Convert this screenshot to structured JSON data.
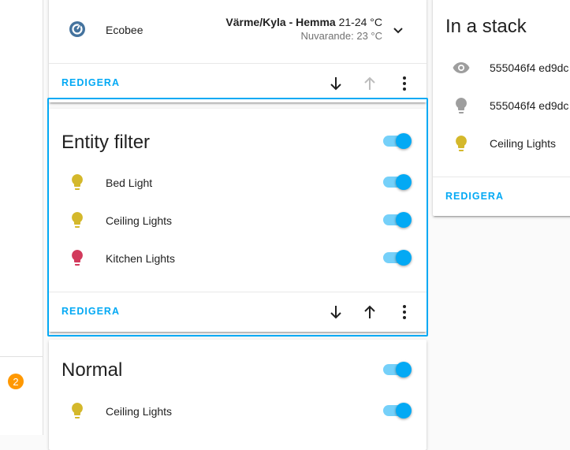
{
  "left_panel": {
    "badge_count": "2"
  },
  "thermostat_card": {
    "entity_name": "Ecobee",
    "state_label": "Värme/Kyla - Hemma",
    "range": "21-24 °C",
    "current": "Nuvarande: 23 °C",
    "edit_label": "REDIGERA"
  },
  "entity_filter_card": {
    "title": "Entity filter",
    "entities": [
      {
        "name": "Bed Light",
        "icon": "bulb-icon",
        "color": "#d4b82b"
      },
      {
        "name": "Ceiling Lights",
        "icon": "bulb-icon",
        "color": "#d4b82b"
      },
      {
        "name": "Kitchen Lights",
        "icon": "bulb-icon",
        "color": "#d23a5c"
      }
    ],
    "edit_label": "REDIGERA"
  },
  "normal_card": {
    "title": "Normal",
    "entities": [
      {
        "name": "Ceiling Lights",
        "icon": "bulb-icon",
        "color": "#d4b82b"
      }
    ]
  },
  "stack_card": {
    "title": "In a stack",
    "entities": [
      {
        "name": "555046f4 ed9dc",
        "icon": "eye-icon",
        "color": "#9e9e9e"
      },
      {
        "name": "555046f4 ed9dc",
        "icon": "bulb-icon",
        "color": "#9e9e9e"
      },
      {
        "name": "Ceiling Lights",
        "icon": "bulb-icon",
        "color": "#d4b82b"
      }
    ],
    "edit_label": "REDIGERA"
  },
  "colors": {
    "accent": "#03a9f4",
    "badge": "#ff9800"
  }
}
